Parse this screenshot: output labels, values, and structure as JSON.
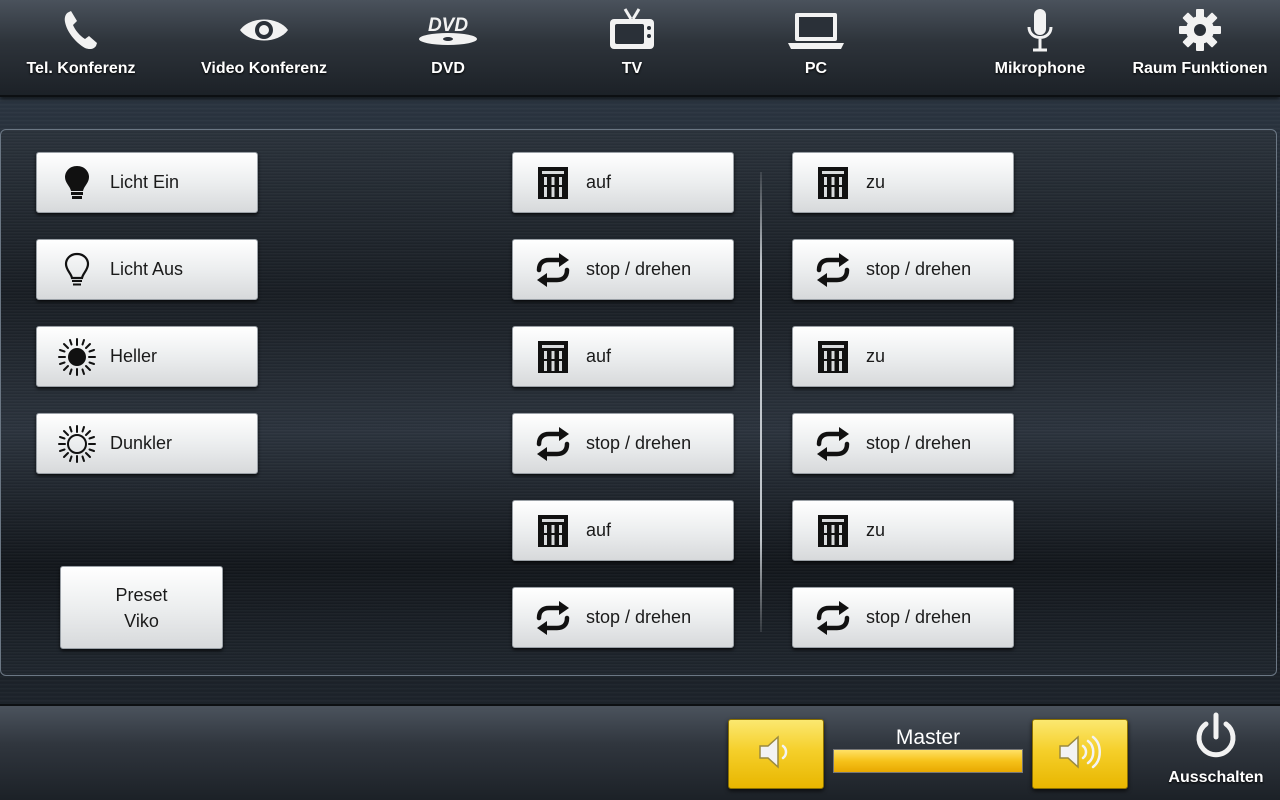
{
  "nav": {
    "items": [
      {
        "label": "Tel. Konferenz",
        "icon": "phone-icon"
      },
      {
        "label": "Video Konferenz",
        "icon": "eye-icon"
      },
      {
        "label": "DVD",
        "icon": "dvd-icon"
      },
      {
        "label": "TV",
        "icon": "tv-icon"
      },
      {
        "label": "PC",
        "icon": "laptop-icon"
      },
      {
        "label": "Mikrophone",
        "icon": "microphone-icon"
      },
      {
        "label": "Raum Funktionen",
        "icon": "gear-icon"
      }
    ]
  },
  "light": {
    "buttons": [
      {
        "label": "Licht Ein",
        "icon": "bulb-on-icon"
      },
      {
        "label": "Licht Aus",
        "icon": "bulb-off-icon"
      },
      {
        "label": "Heller",
        "icon": "sun-bright-icon"
      },
      {
        "label": "Dunkler",
        "icon": "sun-dim-icon"
      }
    ],
    "preset": {
      "line1": "Preset",
      "line2": "Viko"
    }
  },
  "blinds": {
    "left": [
      {
        "label": "auf",
        "icon": "blind-icon"
      },
      {
        "label": "stop / drehen",
        "icon": "repeat-icon"
      },
      {
        "label": "auf",
        "icon": "blind-icon"
      },
      {
        "label": "stop / drehen",
        "icon": "repeat-icon"
      },
      {
        "label": "auf",
        "icon": "blind-icon"
      },
      {
        "label": "stop / drehen",
        "icon": "repeat-icon"
      }
    ],
    "right": [
      {
        "label": "zu",
        "icon": "blind-icon"
      },
      {
        "label": "stop / drehen",
        "icon": "repeat-icon"
      },
      {
        "label": "zu",
        "icon": "blind-icon"
      },
      {
        "label": "stop / drehen",
        "icon": "repeat-icon"
      },
      {
        "label": "zu",
        "icon": "blind-icon"
      },
      {
        "label": "stop / drehen",
        "icon": "repeat-icon"
      }
    ]
  },
  "audio": {
    "master_label": "Master",
    "master_level_percent": 100,
    "volume_down_icon": "volume-down-icon",
    "volume_up_icon": "volume-up-icon"
  },
  "power": {
    "label": "Ausschalten",
    "icon": "power-icon"
  },
  "colors": {
    "accent": "#f5cf2a",
    "button_face": "#eceeef",
    "nav_text": "#ffffff"
  }
}
